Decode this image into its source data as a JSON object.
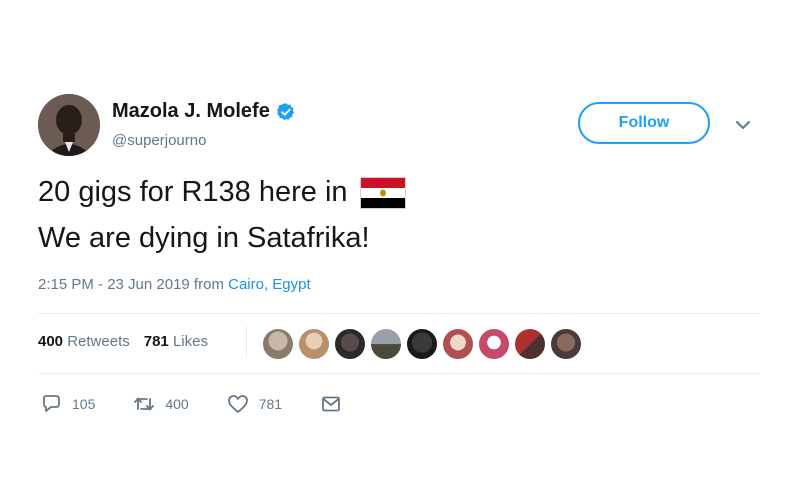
{
  "user": {
    "name": "Mazola J. Molefe",
    "handle": "@superjourno",
    "verified": true
  },
  "follow_label": "Follow",
  "tweet": {
    "line1": "20 gigs for R138 here in",
    "line2": "We are dying in Satafrika!",
    "flag_icon": "egypt-flag-icon"
  },
  "meta": {
    "time_date": "2:15 PM - 23 Jun 2019 from",
    "location": "Cairo, Egypt"
  },
  "stats": {
    "retweets_count": "400",
    "retweets_label": "Retweets",
    "likes_count": "781",
    "likes_label": "Likes",
    "liker_avatars": 9
  },
  "actions": {
    "reply_count": "105",
    "retweet_count": "400",
    "like_count": "781"
  },
  "colors": {
    "accent": "#1da1f2",
    "text": "#14171a",
    "muted": "#657786",
    "divider": "#e6ecf0"
  }
}
